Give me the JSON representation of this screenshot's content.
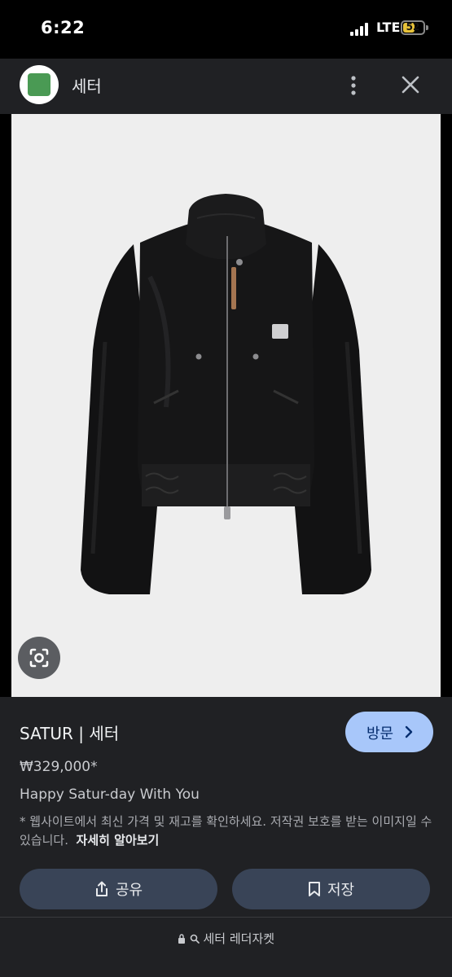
{
  "status": {
    "time": "6:22",
    "network": "LTE",
    "battery": "52",
    "battery_level": 0.52
  },
  "header": {
    "title": "세터",
    "site_icon_color": "#4a9a54"
  },
  "product": {
    "title": "SATUR | 세터",
    "price": "₩329,000*",
    "description": "Happy Satur-day With You",
    "disclaimer": "* 웹사이트에서 최신 가격 및 재고를 확인하세요. 저작권 보호를 받는 이미지일 수 있습니다.",
    "learn_more": "자세히 알아보기"
  },
  "buttons": {
    "visit": "방문",
    "share": "공유",
    "save": "저장"
  },
  "footer": {
    "query": "세터 레더자켓"
  },
  "colors": {
    "accent": "#a8c7fa",
    "panel": "#202124",
    "button": "#394457"
  },
  "icons": [
    "signal-icon",
    "site-icon",
    "more-vert-icon",
    "close-icon",
    "lens-icon",
    "chevron-right-icon",
    "share-icon",
    "bookmark-icon",
    "lock-icon",
    "search-icon"
  ]
}
